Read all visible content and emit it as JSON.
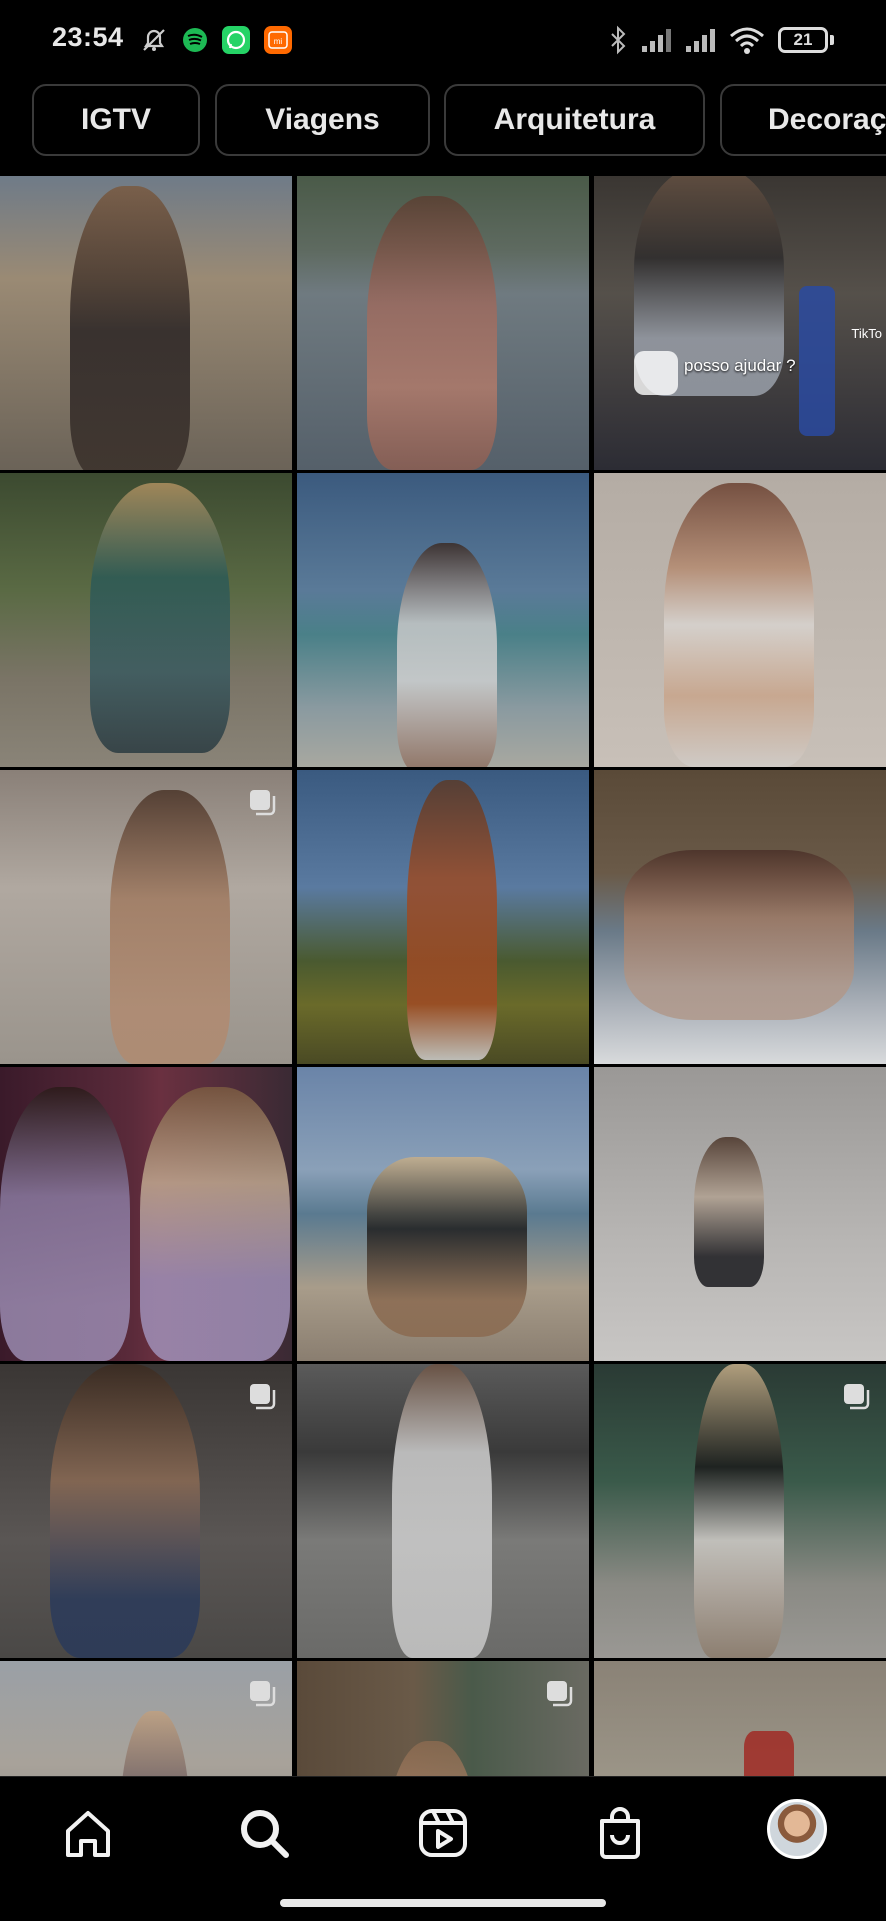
{
  "status_bar": {
    "time": "23:54",
    "battery": "21",
    "icons": [
      "mute-bell-icon",
      "spotify-icon",
      "whatsapp-icon",
      "mi-icon",
      "bluetooth-icon",
      "signal-icon",
      "signal-icon",
      "wifi-icon",
      "battery-icon"
    ]
  },
  "categories": [
    {
      "label": "IGTV"
    },
    {
      "label": "Viagens"
    },
    {
      "label": "Arquitetura"
    },
    {
      "label": "Decoraç"
    }
  ],
  "grid": {
    "caption_tile": {
      "caption": "posso ajudar ?",
      "tiktok": "TikTo"
    },
    "tiles": [
      {
        "multi": false
      },
      {
        "multi": false
      },
      {
        "multi": false
      },
      {
        "multi": false
      },
      {
        "multi": false
      },
      {
        "multi": false
      },
      {
        "multi": true
      },
      {
        "multi": false
      },
      {
        "multi": false
      },
      {
        "multi": false
      },
      {
        "multi": false
      },
      {
        "multi": false
      },
      {
        "multi": true
      },
      {
        "multi": false
      },
      {
        "multi": true
      },
      {
        "multi": true
      },
      {
        "multi": true
      },
      {
        "multi": false
      }
    ]
  },
  "bottom_nav": {
    "items": [
      {
        "icon": "home-icon"
      },
      {
        "icon": "search-icon"
      },
      {
        "icon": "reels-icon"
      },
      {
        "icon": "shop-icon"
      },
      {
        "icon": "profile-avatar"
      }
    ]
  },
  "colors": {
    "background": "#000000",
    "text": "#e8e8e8",
    "pill_border": "#3a3a3a"
  }
}
